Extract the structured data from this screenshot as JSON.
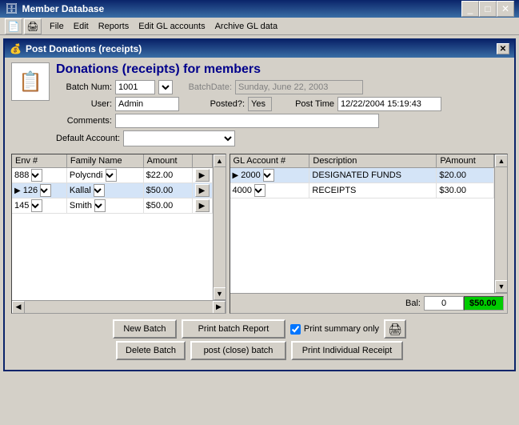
{
  "outer_window": {
    "title": "Member Database",
    "icon": "🗄"
  },
  "menu": {
    "items": [
      "File",
      "Edit",
      "Reports",
      "Edit GL accounts",
      "Archive GL data"
    ]
  },
  "dialog": {
    "title": "Post Donations (receipts)",
    "icon": "💰",
    "close_label": "✕"
  },
  "header": {
    "title": "Donations (receipts) for members",
    "icon": "📄"
  },
  "form": {
    "batch_num_label": "Batch Num:",
    "batch_num_value": "1001",
    "batch_date_label": "BatchDate:",
    "batch_date_value": "Sunday, June 22, 2003",
    "user_label": "User:",
    "user_value": "Admin",
    "posted_label": "Posted?:",
    "posted_value": "Yes",
    "post_time_label": "Post Time",
    "post_time_value": "12/22/2004 15:19:43",
    "comments_label": "Comments:",
    "comments_value": "",
    "default_account_label": "Default Account:"
  },
  "left_table": {
    "columns": [
      "Env #",
      "Family Name",
      "Amount",
      ""
    ],
    "rows": [
      {
        "env": "888",
        "name": "Polycndi",
        "amount": "$22.00",
        "selected": false
      },
      {
        "env": "126",
        "name": "Kallal",
        "amount": "$50.00",
        "selected": true
      },
      {
        "env": "145",
        "name": "Smith",
        "amount": "$50.00",
        "selected": false
      }
    ]
  },
  "right_table": {
    "columns": [
      "GL Account #",
      "Description",
      "PAmount"
    ],
    "rows": [
      {
        "gl": "2000",
        "desc": "DESIGNATED FUNDS",
        "amount": "$20.00",
        "selected": true
      },
      {
        "gl": "4000",
        "desc": "RECEIPTS",
        "amount": "$30.00",
        "selected": false
      }
    ]
  },
  "balance": {
    "label": "Bal:",
    "input_value": "0",
    "total_value": "$50.00"
  },
  "buttons": {
    "new_batch": "New Batch",
    "print_batch_report": "Print batch Report",
    "print_summary_only_label": "Print summary only",
    "delete_batch": "Delete Batch",
    "post_close_batch": "post (close) batch",
    "print_individual_receipt": "Print Individual Receipt"
  },
  "colors": {
    "title_bar_start": "#0a246a",
    "title_bar_end": "#3a6ea5",
    "balance_bg": "#00cc00",
    "selected_row": "#d4e4f7"
  }
}
